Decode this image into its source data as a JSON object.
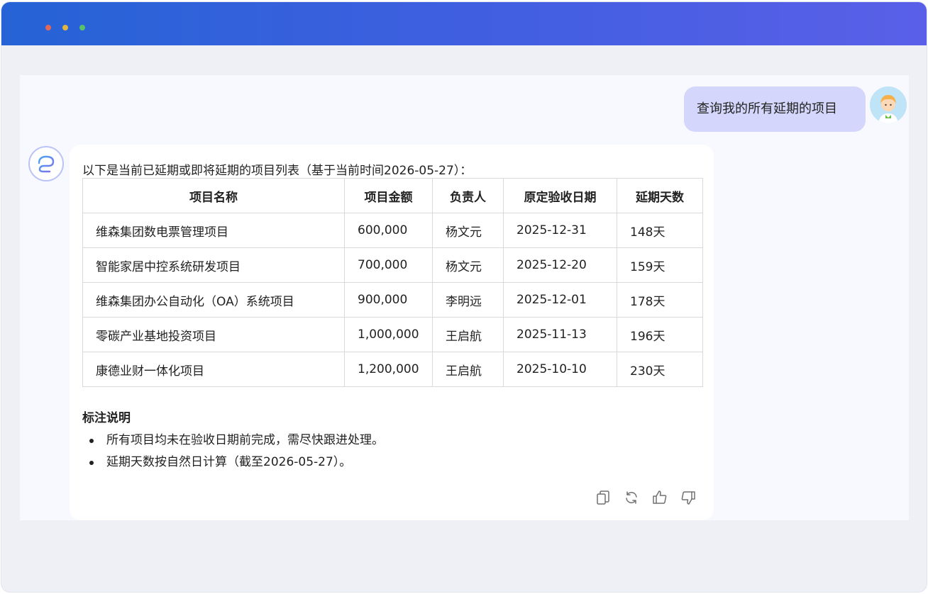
{
  "chat": {
    "user_message": "查询我的所有延期的项目",
    "assistant": {
      "intro": "以下是当前已延期或即将延期的项目列表（基于当前时间2026-05-27）：",
      "table": {
        "headers": [
          "项目名称",
          "项目金额",
          "负责人",
          "原定验收日期",
          "延期天数"
        ],
        "rows": [
          [
            "维森集团数电票管理项目",
            "600,000",
            "杨文元",
            "2025-12-31",
            "148天"
          ],
          [
            "智能家居中控系统研发项目",
            "700,000",
            "杨文元",
            "2025-12-20",
            "159天"
          ],
          [
            "维森集团办公自动化（OA）系统项目",
            "900,000",
            "李明远",
            "2025-12-01",
            "178天"
          ],
          [
            "零碳产业基地投资项目",
            "1,000,000",
            "王启航",
            "2025-11-13",
            "196天"
          ],
          [
            "康德业财一体化项目",
            "1,200,000",
            "王启航",
            "2025-10-10",
            "230天"
          ]
        ]
      },
      "notes_title": "标注说明",
      "notes": [
        "所有项目均未在验收日期前完成，需尽快跟进处理。",
        "延期天数按自然日计算（截至2026-05-27）。"
      ],
      "actions": [
        "copy-icon",
        "refresh-icon",
        "thumbs-up-icon",
        "thumbs-down-icon"
      ]
    }
  },
  "colors": {
    "titlebar_start": "#2563d6",
    "titlebar_end": "#5a5fe8",
    "user_bubble": "#d4d7fb",
    "panel_bg": "#f8f9fe"
  }
}
